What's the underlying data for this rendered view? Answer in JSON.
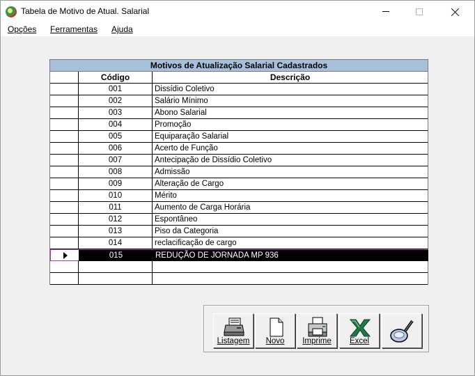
{
  "window": {
    "title": "Tabela de Motivo de Atual. Salarial",
    "icon": "app-globe-icon"
  },
  "menu": {
    "items": [
      {
        "label": "Opções"
      },
      {
        "label": "Ferramentas"
      },
      {
        "label": "Ajuda"
      }
    ]
  },
  "grid": {
    "caption": "Motivos de Atualização Salarial Cadastrados",
    "col_code": "Código",
    "col_desc": "Descrição",
    "selected_index": 14,
    "rows": [
      {
        "code": "001",
        "desc": "Dissídio Coletivo"
      },
      {
        "code": "002",
        "desc": "Salário Mínimo"
      },
      {
        "code": "003",
        "desc": "Abono Salarial"
      },
      {
        "code": "004",
        "desc": "Promoção"
      },
      {
        "code": "005",
        "desc": "Equiparação Salarial"
      },
      {
        "code": "006",
        "desc": "Acerto de Função"
      },
      {
        "code": "007",
        "desc": "Antecipação de Dissídio Coletivo"
      },
      {
        "code": "008",
        "desc": "Admissão"
      },
      {
        "code": "009",
        "desc": "Alteração de Cargo"
      },
      {
        "code": "010",
        "desc": "Mérito"
      },
      {
        "code": "011",
        "desc": "Aumento de Carga Horária"
      },
      {
        "code": "012",
        "desc": "Espontâneo"
      },
      {
        "code": "013",
        "desc": "Piso da Categoria"
      },
      {
        "code": "014",
        "desc": "reclacificação de cargo"
      },
      {
        "code": "015",
        "desc": "REDUÇÃO DE JORNADA MP 936"
      },
      {
        "code": "",
        "desc": ""
      },
      {
        "code": "",
        "desc": ""
      }
    ]
  },
  "toolbar": {
    "listagem": "Listagem",
    "novo": "Novo",
    "imprime": "Imprime",
    "excel": "Excel",
    "search_icon": "magnifier-icon"
  },
  "colors": {
    "caption_bg": "#a6c0db",
    "selected_bg": "#000000",
    "selected_border": "#b03ab0"
  }
}
